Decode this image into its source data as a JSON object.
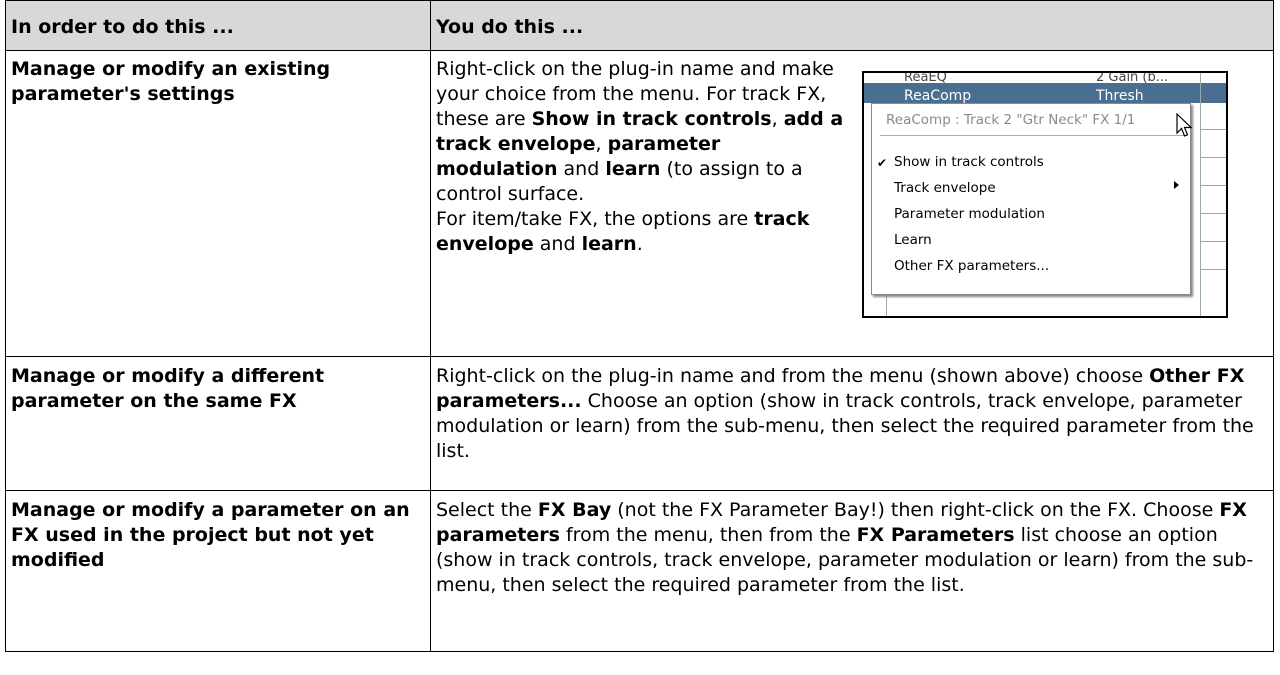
{
  "header": {
    "col1": "In order to do this ...",
    "col2": "You do this ..."
  },
  "row1": {
    "action": "Manage or modify an existing parameter's settings",
    "p1a": "Right-click on the plug-in name and make your choice from the menu. For track FX, these are ",
    "b1": "Show in track controls",
    "p1b": ", ",
    "b2": "add a track envelope",
    "p1c": ", ",
    "b3": "parameter modulation",
    "p1d": " and ",
    "b4": "learn",
    "p1e": " (to assign to a control surface.",
    "p2a": "For item/take FX, the options are ",
    "b5": "track envelope",
    "p2b": " and ",
    "b6": "learn",
    "p2c": "."
  },
  "screenshot": {
    "top_left": "ReaEQ",
    "top_right": "2 Gain (b...",
    "selected_left": "ReaComp",
    "selected_right": "Thresh",
    "menu_title": "ReaComp : Track 2 \"Gtr Neck\"  FX 1/1",
    "items": [
      "Show in track controls",
      "Track envelope",
      "Parameter modulation",
      "Learn",
      "Other FX parameters..."
    ],
    "checked_item": "Show in track controls",
    "submenu_item": "Track envelope",
    "icons": {
      "check": "checkmark-icon",
      "arrow": "submenu-arrow-icon",
      "cursor": "mouse-cursor-icon"
    }
  },
  "row2": {
    "action": "Manage or modify a different parameter on the same FX",
    "t1": "Right-click on the plug-in name and from the menu (shown above) choose ",
    "b1": "Other FX parameters...",
    "t2": " Choose an option (show in track controls, track envelope, parameter modulation or learn) from the sub-menu, then select the required parameter from the list."
  },
  "row3": {
    "action": "Manage or modify a parameter on an FX used in the project but not yet modified",
    "t1": "Select the ",
    "b1": "FX Bay",
    "t2": " (not the FX Parameter Bay!) then right-click on the FX. Choose ",
    "b2": "FX parameters",
    "t3": " from the menu, then from the ",
    "b3": "FX Parameters",
    "t4": " list choose an option (show in track controls, track envelope, parameter modulation or learn) from the sub-menu, then select the required parameter from the list."
  }
}
